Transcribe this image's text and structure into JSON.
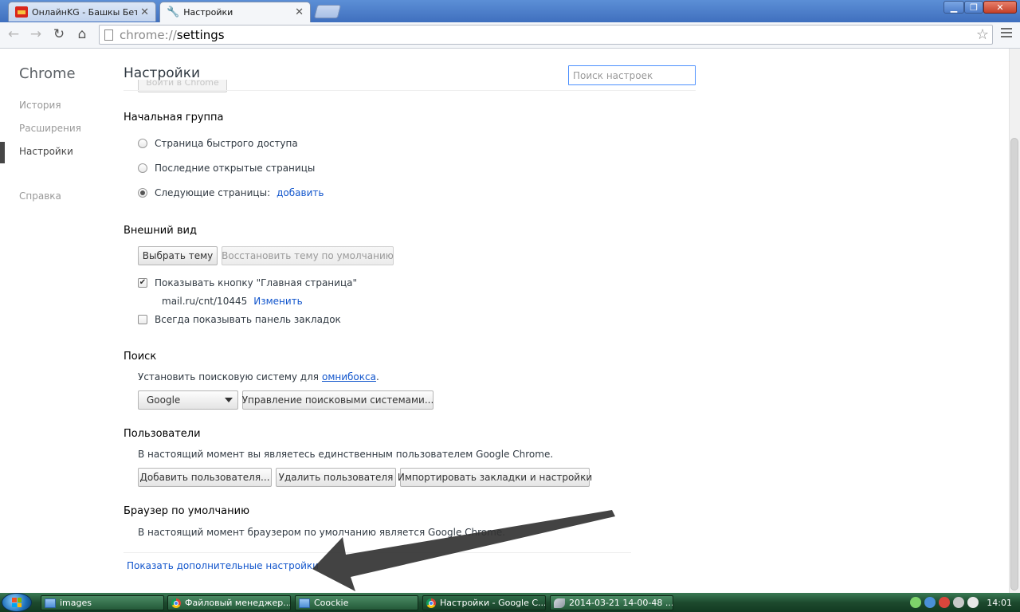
{
  "browser": {
    "tabs": [
      {
        "title": "ОнлайнKG - Башкы Бет",
        "icon": "bet-favicon-icon"
      },
      {
        "title": "Настройки",
        "icon": "wrench-icon"
      }
    ],
    "address": {
      "scheme": "chrome://",
      "path": "settings"
    }
  },
  "sidebar": {
    "brand": "Chrome",
    "items": [
      {
        "label": "История"
      },
      {
        "label": "Расширения"
      },
      {
        "label": "Настройки",
        "selected": true
      },
      {
        "label": "Справка"
      }
    ]
  },
  "page": {
    "title": "Настройки",
    "search_placeholder": "Поиск настроек",
    "partial_button": "Войти в Chrome"
  },
  "startup": {
    "title": "Начальная группа",
    "options": [
      {
        "label": "Страница быстрого доступа",
        "checked": false
      },
      {
        "label": "Последние открытые страницы",
        "checked": false
      },
      {
        "label": "Следующие страницы:",
        "checked": true
      }
    ],
    "add_link": "добавить"
  },
  "appearance": {
    "title": "Внешний вид",
    "choose_theme": "Выбрать тему",
    "reset_theme": "Восстановить тему по умолчанию",
    "home_button_label": "Показывать кнопку \"Главная страница\"",
    "home_button_checked": true,
    "home_url": "mail.ru/cnt/10445",
    "change_link": "Изменить",
    "bookmarks_bar_label": "Всегда показывать панель закладок",
    "bookmarks_bar_checked": false
  },
  "search": {
    "title": "Поиск",
    "desc_prefix": "Установить поисковую систему для",
    "desc_link": "омнибокса",
    "desc_suffix": ".",
    "engine": "Google",
    "manage_button": "Управление поисковыми системами..."
  },
  "users": {
    "title": "Пользователи",
    "desc": "В настоящий момент вы являетесь единственным пользователем Google Chrome.",
    "add_button": "Добавить пользователя...",
    "delete_button": "Удалить пользователя",
    "import_button": "Импортировать закладки и настройки"
  },
  "default_browser": {
    "title": "Браузер по умолчанию",
    "desc": "В настоящий момент браузером по умолчанию является Google Chrome."
  },
  "advanced_link": "Показать дополнительные настройки",
  "taskbar": {
    "tasks": [
      {
        "label": "images",
        "icon": "folder-icon"
      },
      {
        "label": "Файловый менеджер...",
        "icon": "chrome-icon"
      },
      {
        "label": "Coockie",
        "icon": "folder-icon"
      },
      {
        "label": "Настройки - Google C...",
        "icon": "chrome-icon"
      },
      {
        "label": "2014-03-21 14-00-48 ...",
        "icon": "image-icon"
      }
    ],
    "clock": "14:01"
  },
  "colors": {
    "accent": "#4d90fe",
    "link": "#1155cc",
    "taskbar": "#1d4a2e"
  }
}
